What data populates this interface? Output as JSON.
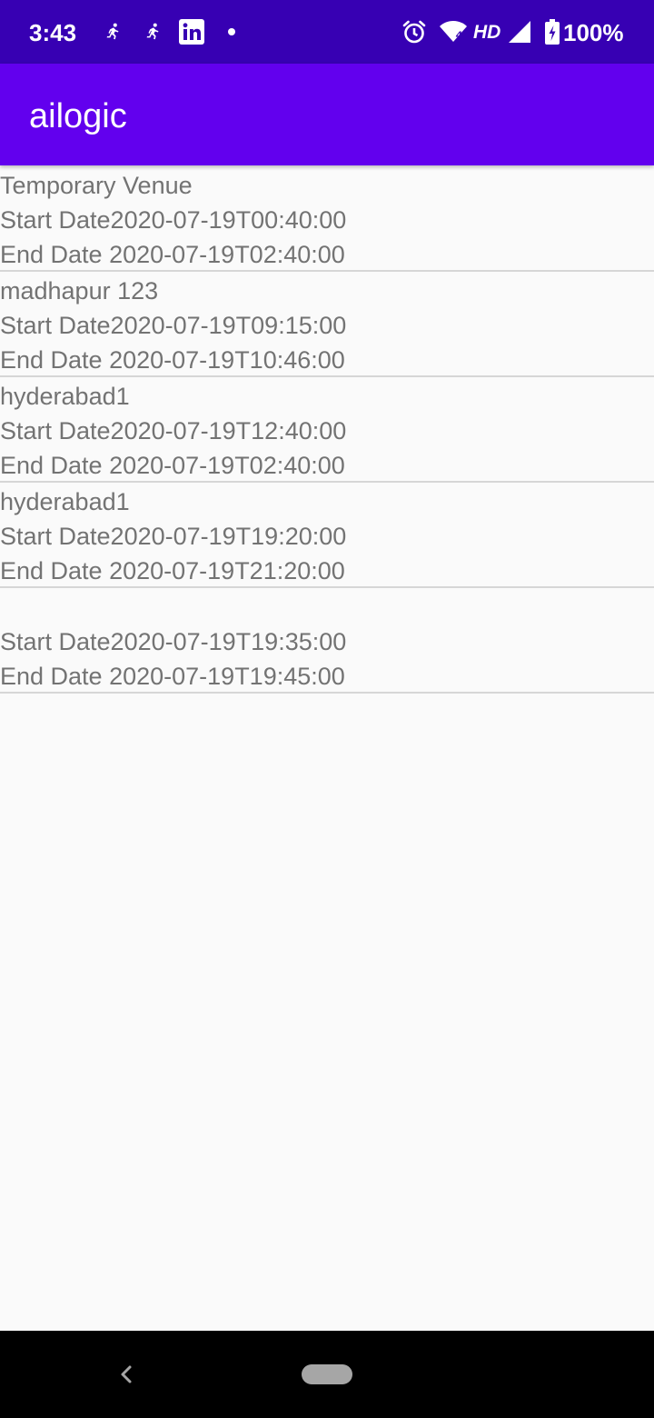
{
  "status_bar": {
    "time": "3:43",
    "network_type": "HD",
    "battery": "100%",
    "icons": [
      "running-person-icon",
      "running-person-icon",
      "linkedin-icon",
      "notification-dot-icon",
      "alarm-icon",
      "wifi-icon",
      "signal-icon",
      "battery-charging-icon"
    ]
  },
  "app_bar": {
    "title": "ailogic"
  },
  "events": [
    {
      "venue": "Temporary Venue",
      "start": "Start Date2020-07-19T00:40:00",
      "end": "End Date 2020-07-19T02:40:00"
    },
    {
      "venue": "madhapur 123",
      "start": "Start Date2020-07-19T09:15:00",
      "end": "End Date 2020-07-19T10:46:00"
    },
    {
      "venue": "hyderabad1",
      "start": "Start Date2020-07-19T12:40:00",
      "end": "End Date 2020-07-19T02:40:00"
    },
    {
      "venue": "hyderabad1",
      "start": "Start Date2020-07-19T19:20:00",
      "end": "End Date 2020-07-19T21:20:00"
    },
    {
      "venue": "",
      "start": "Start Date2020-07-19T19:35:00",
      "end": "End Date 2020-07-19T19:45:00"
    }
  ],
  "nav_bar": {
    "icons": [
      "back-icon",
      "home-pill-icon"
    ]
  },
  "colors": {
    "status_bar": "#3700b3",
    "app_bar": "#6200ee",
    "background": "#fafafa",
    "text": "#737373",
    "divider": "#d6d6d6"
  }
}
